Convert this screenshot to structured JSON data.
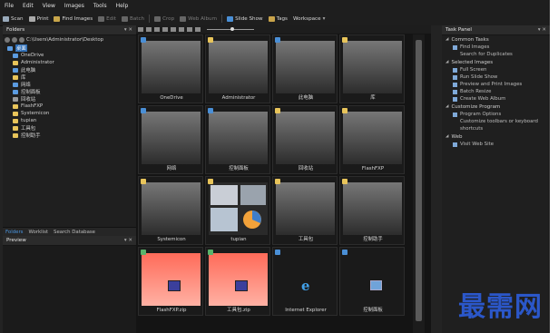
{
  "menu": [
    "File",
    "Edit",
    "View",
    "Images",
    "Tools",
    "Help"
  ],
  "toolbar": [
    {
      "label": "Scan",
      "enabled": true
    },
    {
      "label": "Print",
      "enabled": true
    },
    {
      "label": "Find Images",
      "enabled": true
    },
    {
      "label": "Edit",
      "enabled": false
    },
    {
      "label": "Batch",
      "enabled": false
    },
    {
      "label": "Crop",
      "enabled": false
    },
    {
      "label": "Web Album",
      "enabled": false
    },
    {
      "label": "Slide Show",
      "enabled": true
    },
    {
      "label": "Tags",
      "enabled": true
    },
    {
      "label": "Workspace",
      "enabled": true
    }
  ],
  "folders": {
    "title": "Folders",
    "path": "C:\\Users\\Administrator\\Desktop",
    "tree": [
      "桌面",
      "OneDrive",
      "Administrator",
      "此电脑",
      "库",
      "网络",
      "控制面板",
      "回收站",
      "FlashFXP",
      "Systemicon",
      "tupian",
      "工具包",
      "控制助手"
    ],
    "selected": "桌面"
  },
  "left_tabs": [
    "Folders",
    "Worklist",
    "Search Database"
  ],
  "preview": {
    "title": "Preview"
  },
  "thumbnails": [
    {
      "name": "OneDrive",
      "style": "gray",
      "badge": "blue"
    },
    {
      "name": "Administrator",
      "style": "gray",
      "badge": "yellow"
    },
    {
      "name": "此电脑",
      "style": "gray",
      "badge": "blue"
    },
    {
      "name": "库",
      "style": "gray",
      "badge": "yellow"
    },
    {
      "name": "网络",
      "style": "gray",
      "badge": "blue"
    },
    {
      "name": "控制面板",
      "style": "gray",
      "badge": "blue"
    },
    {
      "name": "回收站",
      "style": "gray",
      "badge": "yellow"
    },
    {
      "name": "FlashFXP",
      "style": "gray",
      "badge": "yellow"
    },
    {
      "name": "Systemicon",
      "style": "gray",
      "badge": "yellow"
    },
    {
      "name": "tupian",
      "style": "images",
      "badge": "yellow"
    },
    {
      "name": "工具包",
      "style": "gray",
      "badge": "yellow"
    },
    {
      "name": "控制助手",
      "style": "gray",
      "badge": "yellow"
    },
    {
      "name": "FlashFXP.zip",
      "style": "red",
      "badge": "green"
    },
    {
      "name": "工具包.zip",
      "style": "red",
      "badge": "green"
    },
    {
      "name": "Internet Explorer",
      "style": "ie",
      "badge": "blue"
    },
    {
      "name": "控制面板",
      "style": "cp",
      "badge": "blue"
    }
  ],
  "task_panel": {
    "title": "Task Panel",
    "sections": [
      {
        "title": "Common Tasks",
        "items": [
          "Find Images",
          "Search for Duplicates"
        ]
      },
      {
        "title": "Selected Images",
        "items": [
          "Full Screen",
          "Run Slide Show",
          "Preview and Print Images",
          "Batch Resize",
          "Create Web Album"
        ]
      },
      {
        "title": "Customize Program",
        "items": [
          "Program Options",
          "Customize toolbars or keyboard shortcuts"
        ]
      },
      {
        "title": "Web",
        "items": [
          "Visit Web Site"
        ]
      }
    ]
  },
  "watermark": "最需网",
  "colors": {
    "selection": "#2f6fb7",
    "tab_active": "#4a95e0",
    "zip_thumb": "#ff6b59",
    "watermark": "#2b57c9"
  }
}
